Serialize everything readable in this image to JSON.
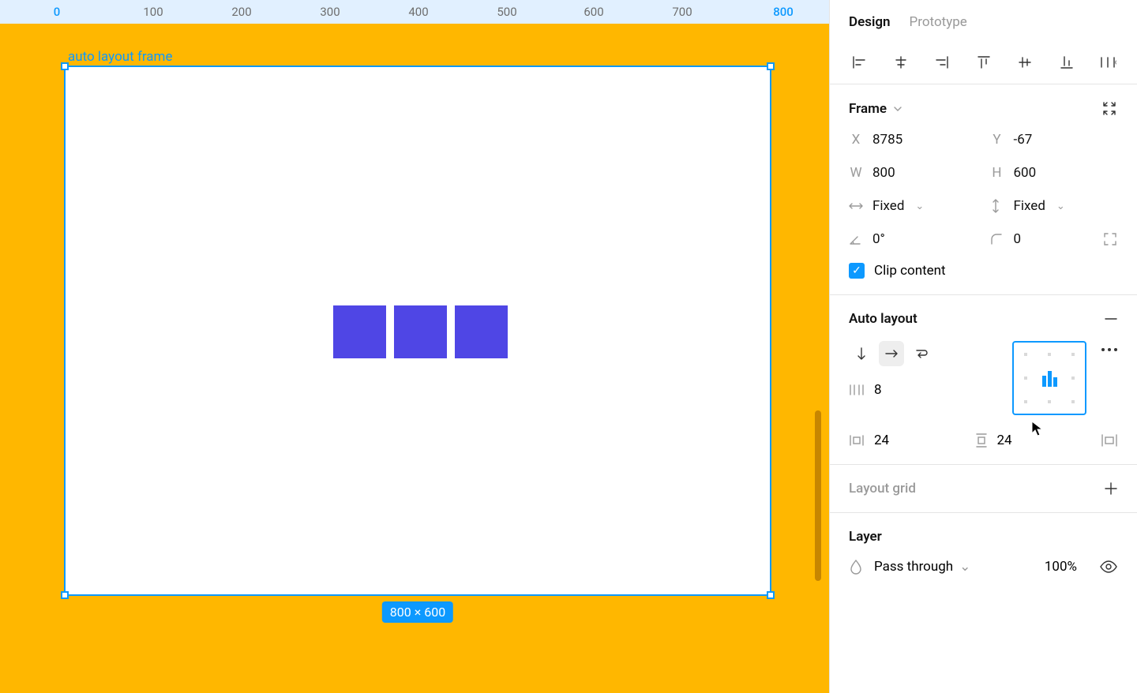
{
  "ruler": {
    "ticks": [
      "0",
      "100",
      "200",
      "300",
      "400",
      "500",
      "600",
      "700",
      "800"
    ]
  },
  "canvas": {
    "frame_label": "auto layout frame",
    "dims_badge": "800 × 600"
  },
  "tabs": {
    "design": "Design",
    "prototype": "Prototype"
  },
  "frame_section": {
    "title": "Frame",
    "x_label": "X",
    "x_value": "8785",
    "y_label": "Y",
    "y_value": "-67",
    "w_label": "W",
    "w_value": "800",
    "h_label": "H",
    "h_value": "600",
    "w_mode": "Fixed",
    "h_mode": "Fixed",
    "rotation": "0°",
    "corner": "0",
    "clip_label": "Clip content"
  },
  "autolayout": {
    "title": "Auto layout",
    "gap_value": "8",
    "pad_h": "24",
    "pad_v": "24"
  },
  "layoutgrid": {
    "title": "Layout grid"
  },
  "layer": {
    "title": "Layer",
    "blend_mode": "Pass through",
    "opacity": "100%"
  }
}
